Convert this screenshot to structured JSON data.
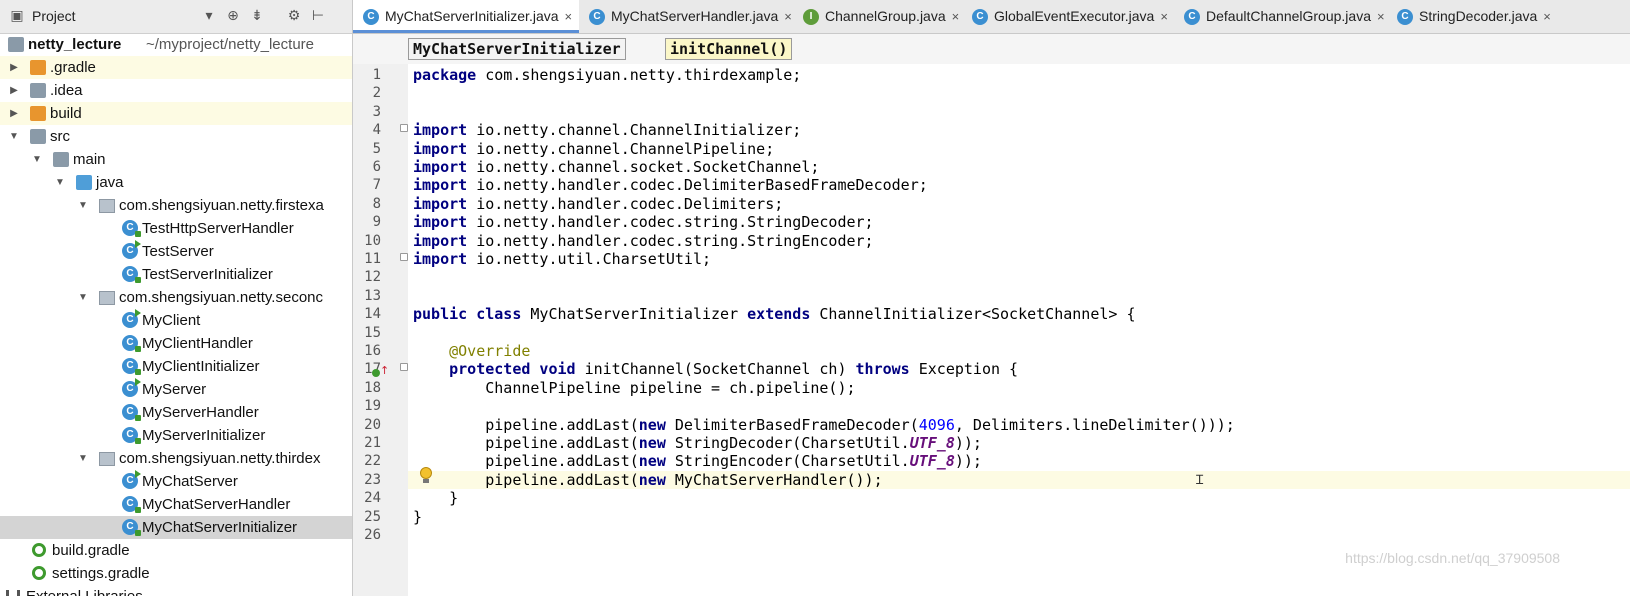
{
  "project_panel": {
    "title": "Project",
    "dropdown_icon": "chevron-down-icon",
    "toolbar_icons": [
      "target-icon",
      "collapse-all-icon",
      "gear-icon",
      "hide-panel-icon"
    ],
    "tree": [
      {
        "label": "netty_lecture",
        "suffix": "~/myproject/netty_lecture",
        "indent": 0,
        "icon": "module-folder-icon",
        "arrow": "",
        "style": "bold"
      },
      {
        "label": ".gradle",
        "indent": 0,
        "icon": "folder-icon-orange",
        "arrow": "▶",
        "style": "hl"
      },
      {
        "label": ".idea",
        "indent": 0,
        "icon": "folder-icon-gray",
        "arrow": "▶",
        "style": ""
      },
      {
        "label": "build",
        "indent": 0,
        "icon": "folder-icon-orange",
        "arrow": "▶",
        "style": "hl"
      },
      {
        "label": "src",
        "indent": 0,
        "icon": "folder-icon-gray",
        "arrow": "▼",
        "style": ""
      },
      {
        "label": "main",
        "indent": 1,
        "icon": "folder-icon-gray",
        "arrow": "▼",
        "style": ""
      },
      {
        "label": "java",
        "indent": 2,
        "icon": "folder-icon-blue",
        "arrow": "▼",
        "style": ""
      },
      {
        "label": "com.shengsiyuan.netty.firstexa",
        "indent": 3,
        "icon": "package-icon",
        "arrow": "▼",
        "style": ""
      },
      {
        "label": "TestHttpServerHandler",
        "indent": 4,
        "icon": "class-icon",
        "arrow": "",
        "style": ""
      },
      {
        "label": "TestServer",
        "indent": 4,
        "icon": "class-runnable-icon",
        "arrow": "",
        "style": ""
      },
      {
        "label": "TestServerInitializer",
        "indent": 4,
        "icon": "class-icon",
        "arrow": "",
        "style": ""
      },
      {
        "label": "com.shengsiyuan.netty.seconc",
        "indent": 3,
        "icon": "package-icon",
        "arrow": "▼",
        "style": ""
      },
      {
        "label": "MyClient",
        "indent": 4,
        "icon": "class-runnable-icon",
        "arrow": "",
        "style": ""
      },
      {
        "label": "MyClientHandler",
        "indent": 4,
        "icon": "class-icon",
        "arrow": "",
        "style": ""
      },
      {
        "label": "MyClientInitializer",
        "indent": 4,
        "icon": "class-icon",
        "arrow": "",
        "style": ""
      },
      {
        "label": "MyServer",
        "indent": 4,
        "icon": "class-runnable-icon",
        "arrow": "",
        "style": ""
      },
      {
        "label": "MyServerHandler",
        "indent": 4,
        "icon": "class-icon",
        "arrow": "",
        "style": ""
      },
      {
        "label": "MyServerInitializer",
        "indent": 4,
        "icon": "class-icon",
        "arrow": "",
        "style": ""
      },
      {
        "label": "com.shengsiyuan.netty.thirdex",
        "indent": 3,
        "icon": "package-icon",
        "arrow": "▼",
        "style": ""
      },
      {
        "label": "MyChatServer",
        "indent": 4,
        "icon": "class-runnable-icon",
        "arrow": "",
        "style": ""
      },
      {
        "label": "MyChatServerHandler",
        "indent": 4,
        "icon": "class-icon",
        "arrow": "",
        "style": ""
      },
      {
        "label": "MyChatServerInitializer",
        "indent": 4,
        "icon": "class-icon",
        "arrow": "",
        "style": "sel"
      },
      {
        "label": "build.gradle",
        "indent": 0,
        "icon": "gradle-icon",
        "arrow": "",
        "style": ""
      },
      {
        "label": "settings.gradle",
        "indent": 0,
        "icon": "gradle-icon",
        "arrow": "",
        "style": ""
      },
      {
        "label": "External Libraries",
        "indent": -1,
        "icon": "library-icon",
        "arrow": "",
        "style": ""
      }
    ]
  },
  "tabs": [
    {
      "label": "MyChatServerInitializer.java",
      "icon": "class-icon",
      "icon_letter": "C",
      "icon_color": "#3b8fd1",
      "active": true
    },
    {
      "label": "MyChatServerHandler.java",
      "icon": "class-icon",
      "icon_letter": "C",
      "icon_color": "#3b8fd1",
      "active": false
    },
    {
      "label": "ChannelGroup.java",
      "icon": "interface-icon",
      "icon_letter": "I",
      "icon_color": "#5e9c3a",
      "active": false
    },
    {
      "label": "GlobalEventExecutor.java",
      "icon": "class-icon",
      "icon_letter": "C",
      "icon_color": "#3b8fd1",
      "active": false
    },
    {
      "label": "DefaultChannelGroup.java",
      "icon": "class-icon",
      "icon_letter": "C",
      "icon_color": "#3b8fd1",
      "active": false
    },
    {
      "label": "StringDecoder.java",
      "icon": "class-icon",
      "icon_letter": "C",
      "icon_color": "#3b8fd1",
      "active": false
    }
  ],
  "breadcrumb": {
    "class_name": "MyChatServerInitializer",
    "method_name": "initChannel()"
  },
  "code_lines": [
    {
      "n": "1",
      "tokens": [
        [
          "kw",
          "package"
        ],
        [
          "",
          "com.shengsiyuan.netty.thirdexample;"
        ]
      ]
    },
    {
      "n": "2",
      "tokens": []
    },
    {
      "n": "3",
      "tokens": []
    },
    {
      "n": "4",
      "tokens": [
        [
          "kw",
          "import"
        ],
        [
          "",
          "io.netty.channel.ChannelInitializer;"
        ]
      ],
      "fold": true
    },
    {
      "n": "5",
      "tokens": [
        [
          "kw",
          "import"
        ],
        [
          "",
          "io.netty.channel.ChannelPipeline;"
        ]
      ]
    },
    {
      "n": "6",
      "tokens": [
        [
          "kw",
          "import"
        ],
        [
          "",
          "io.netty.channel.socket.SocketChannel;"
        ]
      ]
    },
    {
      "n": "7",
      "tokens": [
        [
          "kw",
          "import"
        ],
        [
          "",
          "io.netty.handler.codec.DelimiterBasedFrameDecoder;"
        ]
      ]
    },
    {
      "n": "8",
      "tokens": [
        [
          "kw",
          "import"
        ],
        [
          "",
          "io.netty.handler.codec.Delimiters;"
        ]
      ]
    },
    {
      "n": "9",
      "tokens": [
        [
          "kw",
          "import"
        ],
        [
          "",
          "io.netty.handler.codec.string.StringDecoder;"
        ]
      ]
    },
    {
      "n": "10",
      "tokens": [
        [
          "kw",
          "import"
        ],
        [
          "",
          "io.netty.handler.codec.string.StringEncoder;"
        ]
      ]
    },
    {
      "n": "11",
      "tokens": [
        [
          "kw",
          "import"
        ],
        [
          "",
          "io.netty.util.CharsetUtil;"
        ]
      ],
      "fold": true
    },
    {
      "n": "12",
      "tokens": []
    },
    {
      "n": "13",
      "tokens": []
    },
    {
      "n": "14",
      "tokens": [
        [
          "kw",
          "public class"
        ],
        [
          "",
          " MyChatServerInitializer "
        ],
        [
          "kw",
          "extends"
        ],
        [
          "",
          " ChannelInitializer<SocketChannel> {"
        ]
      ]
    },
    {
      "n": "15",
      "tokens": []
    },
    {
      "n": "16",
      "tokens": [
        [
          "",
          "    "
        ],
        [
          "ann",
          "@Override"
        ]
      ]
    },
    {
      "n": "17",
      "tokens": [
        [
          "",
          "    "
        ],
        [
          "kw",
          "protected void"
        ],
        [
          "",
          " initChannel(SocketChannel ch) "
        ],
        [
          "kw",
          "throws"
        ],
        [
          "",
          " Exception {"
        ]
      ],
      "fold": true
    },
    {
      "n": "18",
      "tokens": [
        [
          "",
          "        ChannelPipeline pipeline = ch.pipeline();"
        ]
      ]
    },
    {
      "n": "19",
      "tokens": []
    },
    {
      "n": "20",
      "tokens": [
        [
          "",
          "        pipeline.addLast("
        ],
        [
          "kw",
          "new"
        ],
        [
          "",
          " DelimiterBasedFrameDecoder("
        ],
        [
          "num",
          "4096"
        ],
        [
          "",
          ", Delimiters.lineDelimiter()));"
        ]
      ]
    },
    {
      "n": "21",
      "tokens": [
        [
          "",
          "        pipeline.addLast("
        ],
        [
          "kw",
          "new"
        ],
        [
          "",
          " StringDecoder(CharsetUtil."
        ],
        [
          "stat",
          "UTF_8"
        ],
        [
          "",
          "));"
        ]
      ]
    },
    {
      "n": "22",
      "tokens": [
        [
          "",
          "        pipeline.addLast("
        ],
        [
          "kw",
          "new"
        ],
        [
          "",
          " StringEncoder(CharsetUtil."
        ],
        [
          "stat",
          "UTF_8"
        ],
        [
          "",
          "));"
        ]
      ]
    },
    {
      "n": "23",
      "tokens": [
        [
          "",
          "        pipeline.addLast("
        ],
        [
          "kw",
          "new"
        ],
        [
          "",
          " MyChatServerHandler());"
        ]
      ],
      "current": true
    },
    {
      "n": "24",
      "tokens": [
        [
          "",
          "    }"
        ]
      ]
    },
    {
      "n": "25",
      "tokens": [
        [
          "",
          "}"
        ]
      ]
    },
    {
      "n": "26",
      "tokens": []
    }
  ],
  "watermark": "https://blog.csdn.net/qq_37909508",
  "colors": {
    "active_tab_underline": "#5b8fd6",
    "keyword": "#000080",
    "annotation": "#808000",
    "number": "#0000ff",
    "static_field": "#660e7a",
    "selection": "#d4d4d4",
    "current_line": "#fdfbe3"
  }
}
